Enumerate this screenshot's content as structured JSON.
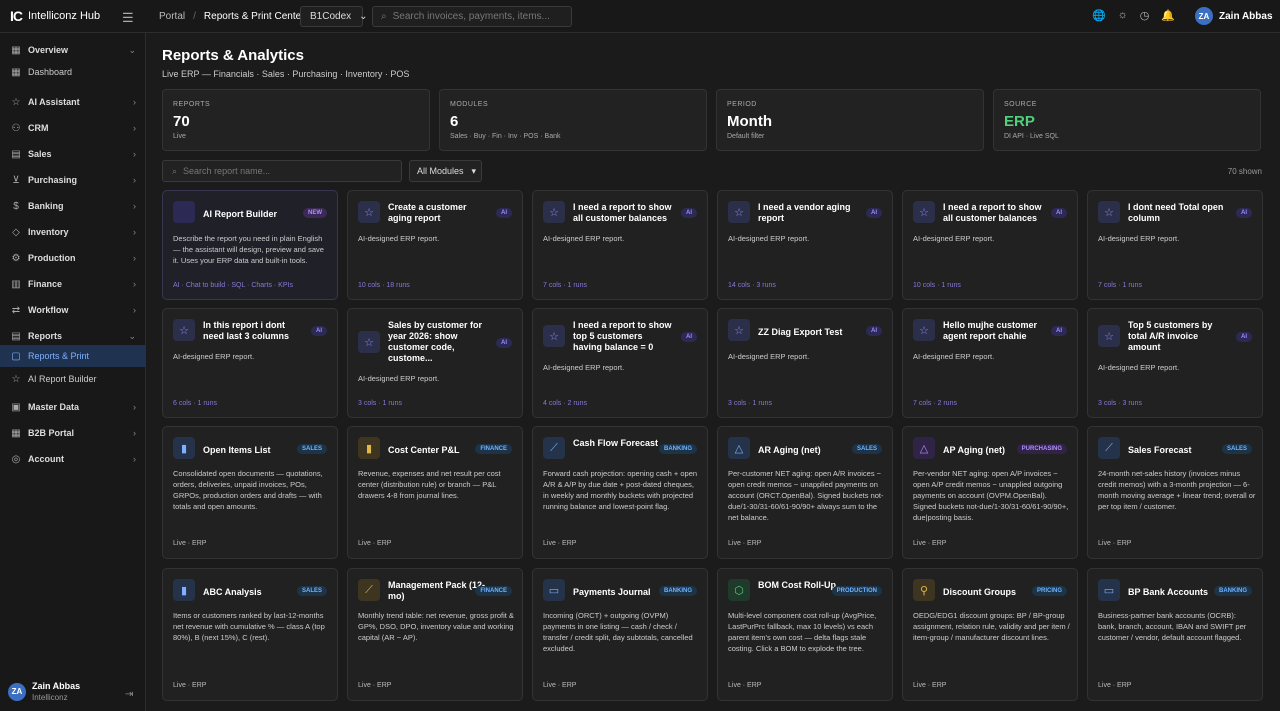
{
  "topbar": {
    "logo": "IC",
    "app_name": "Intelliconz Hub",
    "breadcrumb": [
      "Portal",
      "Reports & Print Center"
    ],
    "company": "B1Codex",
    "search_placeholder": "Search invoices, payments, items...",
    "user_initials": "ZA",
    "user_name": "Zain Abbas"
  },
  "sidebar": {
    "items": [
      {
        "label": "Overview",
        "icon": "grid-icon",
        "expanded": true
      },
      {
        "label": "Dashboard",
        "icon": "grid-icon",
        "sub": true
      },
      {
        "label": "AI Assistant",
        "icon": "star-icon"
      },
      {
        "label": "CRM",
        "icon": "people-icon"
      },
      {
        "label": "Sales",
        "icon": "sales-icon"
      },
      {
        "label": "Purchasing",
        "icon": "cart-icon"
      },
      {
        "label": "Banking",
        "icon": "dollar-icon"
      },
      {
        "label": "Inventory",
        "icon": "box-icon"
      },
      {
        "label": "Production",
        "icon": "gear-icon"
      },
      {
        "label": "Finance",
        "icon": "finance-icon"
      },
      {
        "label": "Workflow",
        "icon": "workflow-icon"
      },
      {
        "label": "Reports",
        "icon": "report-icon",
        "expanded": true
      },
      {
        "label": "Reports & Print",
        "icon": "document-icon",
        "sub": true,
        "active": true
      },
      {
        "label": "AI Report Builder",
        "icon": "star-icon",
        "sub": true
      },
      {
        "label": "Master Data",
        "icon": "database-icon"
      },
      {
        "label": "B2B Portal",
        "icon": "portal-icon"
      },
      {
        "label": "Account",
        "icon": "account-icon"
      }
    ],
    "footer_initials": "ZA",
    "footer_name": "Zain Abbas",
    "footer_org": "Intelliconz"
  },
  "page": {
    "title": "Reports & Analytics",
    "subtitle": "Live ERP — Financials · Sales · Purchasing · Inventory · POS"
  },
  "stats": [
    {
      "label": "REPORTS",
      "value": "70",
      "sub": "Live"
    },
    {
      "label": "MODULES",
      "value": "6",
      "sub": "Sales · Buy · Fin · Inv · POS · Bank"
    },
    {
      "label": "PERIOD",
      "value": "Month",
      "sub": "Default filter"
    },
    {
      "label": "SOURCE",
      "value": "ERP",
      "sub": "DI API · Live SQL"
    }
  ],
  "filters": {
    "search_placeholder": "Search report name...",
    "module_select": "All Modules",
    "shown": "70 shown"
  },
  "cards_row1": [
    {
      "title": "AI Report Builder",
      "badge": "NEW",
      "desc": "Describe the report you need in plain English — the assistant will design, preview and save it. Uses your ERP data and built-in tools.",
      "foot": "AI · Chat to build · SQL · Charts · KPIs"
    },
    {
      "title": "Create a customer aging report",
      "badge": "AI",
      "desc": "AI-designed ERP report.",
      "foot": "10 cols · 18 runs"
    },
    {
      "title": "I need a report to show all customer balances",
      "badge": "AI",
      "desc": "AI-designed ERP report.",
      "foot": "7 cols · 1 runs"
    },
    {
      "title": "I need a vendor aging report",
      "badge": "AI",
      "desc": "AI-designed ERP report.",
      "foot": "14 cols · 3 runs"
    },
    {
      "title": "I need a report to show all customer balances",
      "badge": "AI",
      "desc": "AI-designed ERP report.",
      "foot": "10 cols · 1 runs"
    },
    {
      "title": "I dont need Total open column",
      "badge": "AI",
      "desc": "AI-designed ERP report.",
      "foot": "7 cols · 1 runs"
    }
  ],
  "cards_row2": [
    {
      "title": "In this report i dont need last 3 columns",
      "badge": "AI",
      "desc": "AI-designed ERP report.",
      "foot": "6 cols · 1 runs"
    },
    {
      "title": "Sales by customer for year 2026: show customer code, custome...",
      "badge": "AI",
      "desc": "AI-designed ERP report.",
      "foot": "3 cols · 1 runs"
    },
    {
      "title": "I need a report to show top 5 customers having balance = 0",
      "badge": "AI",
      "desc": "AI-designed ERP report.",
      "foot": "4 cols · 2 runs"
    },
    {
      "title": "ZZ Diag Export Test",
      "badge": "AI",
      "desc": "AI-designed ERP report.",
      "foot": "3 cols · 1 runs"
    },
    {
      "title": "Hello mujhe customer agent report chahie",
      "badge": "AI",
      "desc": "AI-designed ERP report.",
      "foot": "7 cols · 2 runs"
    },
    {
      "title": "Top 5 customers by total A/R invoice amount",
      "badge": "AI",
      "desc": "AI-designed ERP report.",
      "foot": "3 cols · 3 runs"
    }
  ],
  "cards_row3": [
    {
      "title": "Open Items List",
      "badge": "SALES",
      "icon": "bar-chart-icon",
      "desc": "Consolidated open documents — quotations, orders, deliveries, unpaid invoices, POs, GRPOs, production orders and drafts — with totals and open amounts.",
      "foot": "Live · ERP"
    },
    {
      "title": "Cost Center P&L",
      "badge": "FINANCE",
      "icon": "bar-chart-icon",
      "desc": "Revenue, expenses and net result per cost center (distribution rule) or branch — P&L drawers 4-8 from journal lines.",
      "foot": "Live · ERP"
    },
    {
      "title": "Cash Flow Forecast",
      "badge": "BANKING",
      "icon": "line-chart-icon",
      "desc": "Forward cash projection: opening cash + open A/R & A/P by due date + post-dated cheques, in weekly and monthly buckets with projected running balance and lowest-point flag.",
      "foot": "Live · ERP"
    },
    {
      "title": "AR Aging (net)",
      "badge": "SALES",
      "icon": "warning-icon",
      "desc": "Per-customer NET aging: open A/R invoices − open credit memos − unapplied payments on account (ORCT.OpenBal). Signed buckets not-due/1-30/31-60/61-90/90+ always sum to the net balance.",
      "foot": "Live · ERP"
    },
    {
      "title": "AP Aging (net)",
      "badge": "PURCHASING",
      "icon": "warning-icon",
      "desc": "Per-vendor NET aging: open A/P invoices − open A/P credit memos − unapplied outgoing payments on account (OVPM.OpenBal). Signed buckets not-due/1-30/31-60/61-90/90+, due|posting basis.",
      "foot": "Live · ERP"
    },
    {
      "title": "Sales Forecast",
      "badge": "SALES",
      "icon": "line-chart-icon",
      "desc": "24-month net-sales history (invoices minus credit memos) with a 3-month projection — 6-month moving average + linear trend; overall or per top item / customer.",
      "foot": "Live · ERP"
    }
  ],
  "cards_row4": [
    {
      "title": "ABC Analysis",
      "badge": "SALES",
      "icon": "bar-chart-icon",
      "desc": "Items or customers ranked by last-12-months net revenue with cumulative % — class A (top 80%), B (next 15%), C (rest).",
      "foot": "Live · ERP"
    },
    {
      "title": "Management Pack (12-mo)",
      "badge": "FINANCE",
      "icon": "line-chart-icon",
      "desc": "Monthly trend table: net revenue, gross profit & GP%, DSO, DPO, inventory value and working capital (AR − AP).",
      "foot": "Live · ERP"
    },
    {
      "title": "Payments Journal",
      "badge": "BANKING",
      "icon": "payments-icon",
      "desc": "Incoming (ORCT) + outgoing (OVPM) payments in one listing — cash / check / transfer / credit split, day subtotals, cancelled excluded.",
      "foot": "Live · ERP"
    },
    {
      "title": "BOM Cost Roll-Up",
      "badge": "PRODUCTION",
      "icon": "cube-icon",
      "desc": "Multi-level component cost roll-up (AvgPrice, LastPurPrc fallback, max 10 levels) vs each parent item's own cost — delta flags stale costing. Click a BOM to explode the tree.",
      "foot": "Live · ERP"
    },
    {
      "title": "Discount Groups",
      "badge": "PRICING",
      "icon": "discount-icon",
      "desc": "OEDG/EDG1 discount groups: BP / BP-group assignment, relation rule, validity and per item / item-group / manufacturer discount lines.",
      "foot": "Live · ERP"
    },
    {
      "title": "BP Bank Accounts",
      "badge": "BANKING",
      "icon": "bank-icon",
      "desc": "Business-partner bank accounts (OCRB): bank, branch, account, IBAN and SWIFT per customer / vendor, default account flagged.",
      "foot": "Live · ERP"
    }
  ]
}
